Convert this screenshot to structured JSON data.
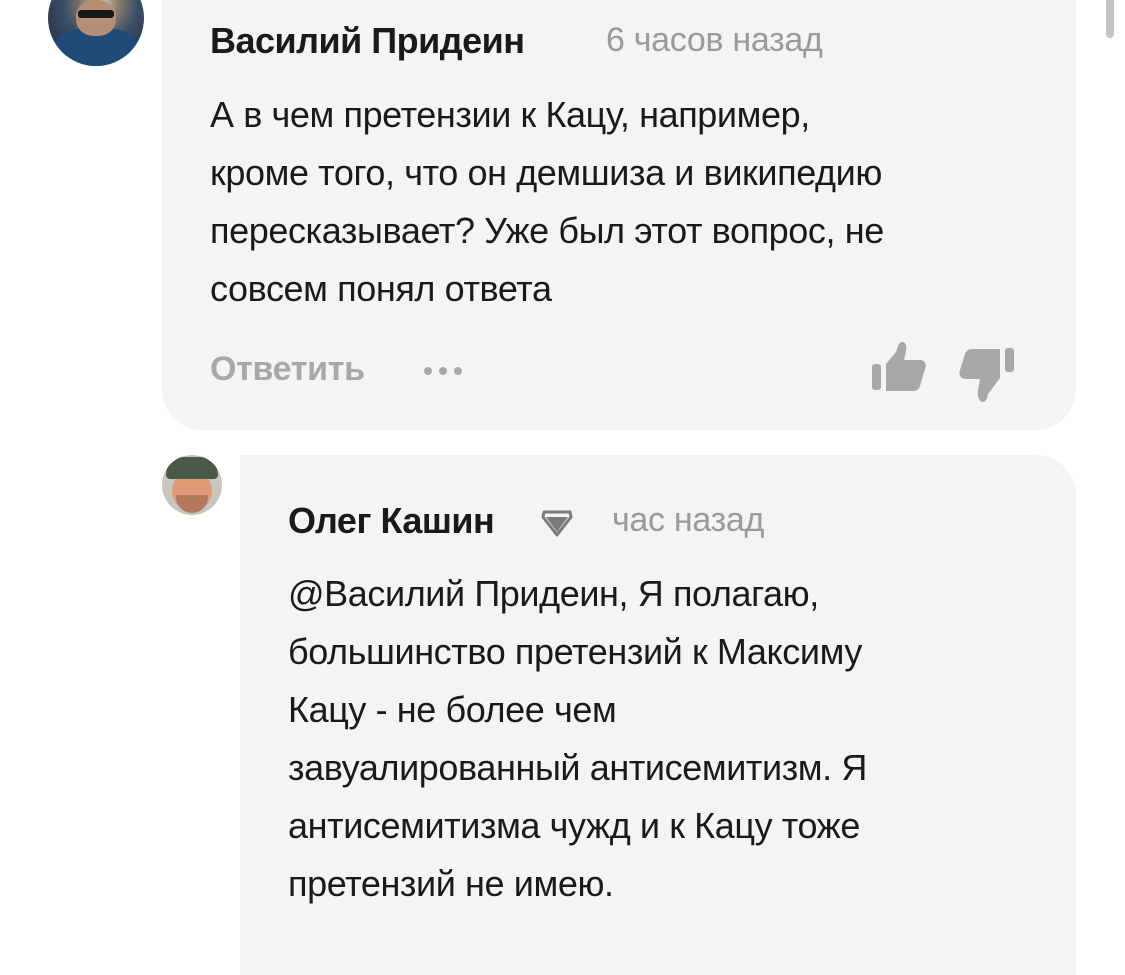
{
  "comments": [
    {
      "author": "Василий Придеин",
      "time": "6 часов назад",
      "text_lines": [
        "А в чем претензии к Кацу, например,",
        "кроме того, что он демшиза и википедию",
        "пересказывает? Уже был этот вопрос, не",
        "совсем понял ответа"
      ],
      "reply_label": "Ответить",
      "more_icon": "ellipsis-icon",
      "like_icon": "thumbs-up-icon",
      "dislike_icon": "thumbs-down-icon"
    },
    {
      "author": "Олег Кашин",
      "badge_icon": "diamond-icon",
      "time": "час назад",
      "text_lines": [
        "@Василий Придеин, Я полагаю,",
        "большинство претензий к Максиму",
        "Кацу - не более чем",
        "завуалированный антисемитизм. Я",
        "антисемитизма чужд и к Кацу тоже",
        "претензий не имею."
      ]
    }
  ],
  "colors": {
    "bubble_bg": "#f4f4f4",
    "text": "#1a1a1a",
    "muted": "#9a9a9a",
    "action": "#a8a8a8"
  }
}
